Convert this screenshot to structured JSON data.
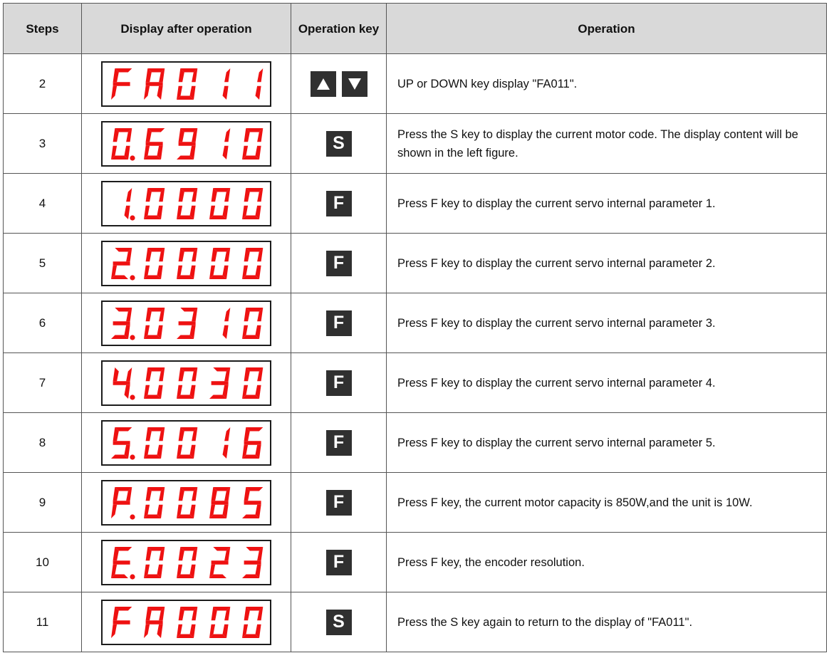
{
  "header": {
    "steps": "Steps",
    "display": "Display after operation",
    "operation_key": "Operation key",
    "operation": "Operation"
  },
  "display_color": "#ee1111",
  "key_color": "#303030",
  "rows": [
    {
      "step": "2",
      "display": [
        "F",
        "A",
        "0",
        "1",
        "1"
      ],
      "dot": -1,
      "keys": [
        "up-arrow-icon",
        "down-arrow-icon"
      ],
      "operation": "UP or DOWN key display \"FA011\"."
    },
    {
      "step": "3",
      "display": [
        "0",
        "6",
        "9",
        "1",
        "0"
      ],
      "dot": 0,
      "keys": [
        "S"
      ],
      "operation": "Press the S key to display the current motor code. The display content will be shown in the left figure."
    },
    {
      "step": "4",
      "display": [
        "1",
        "0",
        "0",
        "0",
        "0"
      ],
      "dot": 0,
      "keys": [
        "F"
      ],
      "operation": "Press F key to display the current servo internal parameter 1."
    },
    {
      "step": "5",
      "display": [
        "2",
        "0",
        "0",
        "0",
        "0"
      ],
      "dot": 0,
      "keys": [
        "F"
      ],
      "operation": "Press F key to display the current servo internal parameter 2."
    },
    {
      "step": "6",
      "display": [
        "3",
        "0",
        "3",
        "1",
        "0"
      ],
      "dot": 0,
      "keys": [
        "F"
      ],
      "operation": "Press F key to display the current servo internal parameter 3."
    },
    {
      "step": "7",
      "display": [
        "4",
        "0",
        "0",
        "3",
        "0"
      ],
      "dot": 0,
      "keys": [
        "F"
      ],
      "operation": "Press F key to display the current servo internal parameter 4."
    },
    {
      "step": "8",
      "display": [
        "5",
        "0",
        "0",
        "1",
        "6"
      ],
      "dot": 0,
      "keys": [
        "F"
      ],
      "operation": "Press F key to display the current servo internal parameter 5."
    },
    {
      "step": "9",
      "display": [
        "P",
        "0",
        "0",
        "8",
        "5"
      ],
      "dot": 0,
      "keys": [
        "F"
      ],
      "operation": "Press F key, the current motor capacity is 850W,and the unit is 10W."
    },
    {
      "step": "10",
      "display": [
        "E",
        "0",
        "0",
        "2",
        "3"
      ],
      "dot": 0,
      "keys": [
        "F"
      ],
      "operation": "Press F key, the encoder resolution."
    },
    {
      "step": "11",
      "display": [
        "F",
        "A",
        "0",
        "0",
        "0"
      ],
      "dot": -1,
      "keys": [
        "S"
      ],
      "operation": "Press the S key again to return to the display of \"FA011\"."
    }
  ]
}
